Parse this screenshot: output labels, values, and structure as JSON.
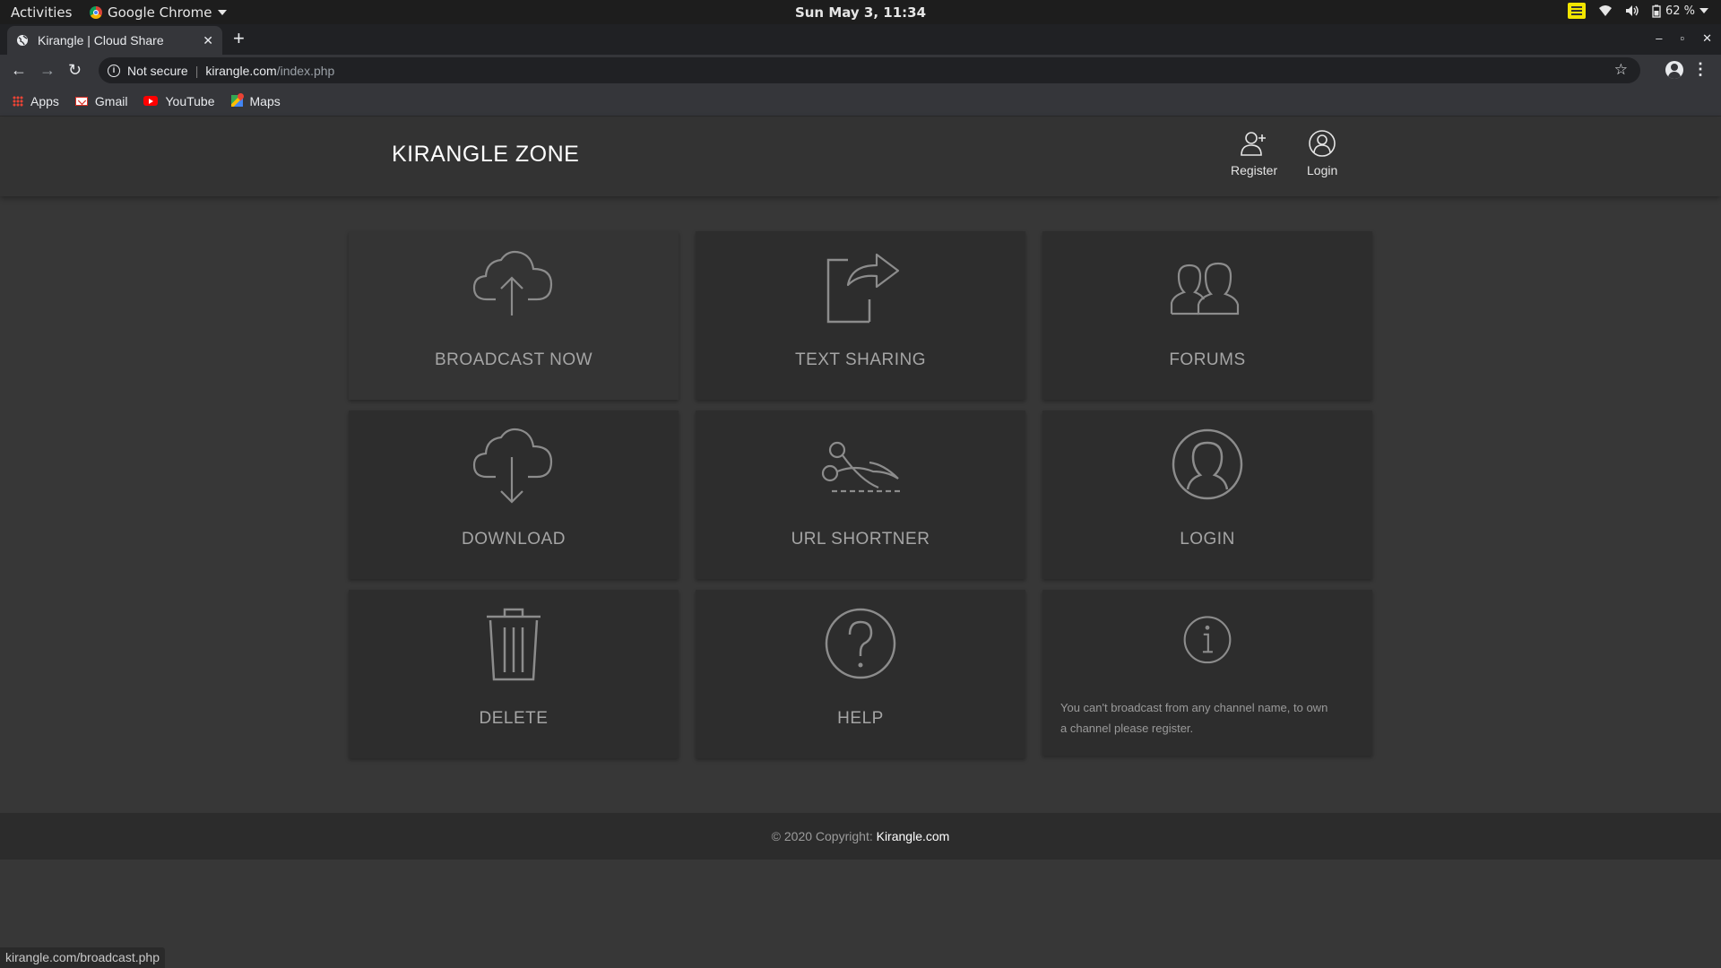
{
  "system_bar": {
    "activities": "Activities",
    "app_name": "Google Chrome",
    "clock": "Sun May  3, 11:34",
    "battery": "62 %"
  },
  "browser": {
    "tab_title": "Kirangle | Cloud Share",
    "security": "Not secure",
    "url_host": "kirangle.com",
    "url_path": "/index.php",
    "bookmarks": [
      "Apps",
      "Gmail",
      "YouTube",
      "Maps"
    ]
  },
  "site": {
    "brand": "KIRANGLE ZONE",
    "nav": {
      "register": "Register",
      "login": "Login"
    },
    "tiles": [
      {
        "label": "BROADCAST NOW",
        "icon": "cloud-upload-icon"
      },
      {
        "label": "TEXT SHARING",
        "icon": "share-icon"
      },
      {
        "label": "FORUMS",
        "icon": "users-icon"
      },
      {
        "label": "DOWNLOAD",
        "icon": "cloud-download-icon"
      },
      {
        "label": "URL SHORTNER",
        "icon": "scissors-icon"
      },
      {
        "label": "LOGIN",
        "icon": "user-circle-icon"
      },
      {
        "label": "DELETE",
        "icon": "trash-icon"
      },
      {
        "label": "HELP",
        "icon": "help-icon"
      },
      {
        "note": "You can't broadcast from any channel name, to own a channel please register.",
        "icon": "info-icon"
      }
    ],
    "footer": {
      "prefix": "© 2020 Copyright: ",
      "link": "Kirangle.com"
    }
  },
  "status_url": "kirangle.com/broadcast.php",
  "colors": {
    "page_bg": "#373737",
    "tile_bg": "#2d2d2d",
    "icon_stroke": "#8c8c8c",
    "label_text": "#a5a5a5"
  }
}
